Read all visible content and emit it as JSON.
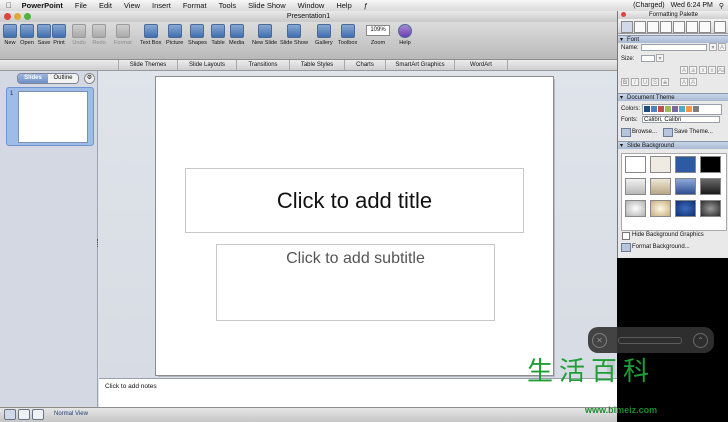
{
  "menubar": {
    "app": "PowerPoint",
    "items": [
      "File",
      "Edit",
      "View",
      "Insert",
      "Format",
      "Tools",
      "Slide Show",
      "Window",
      "Help"
    ],
    "battery": "(Charged)",
    "clock": "Wed 6:24 PM"
  },
  "window": {
    "title": "Presentation1"
  },
  "toolbar": {
    "buttons": [
      "New",
      "Open",
      "Save",
      "Print",
      "Undo",
      "Redo",
      "Format",
      "Text Box",
      "Picture",
      "Shapes",
      "Table",
      "Media",
      "New Slide",
      "Slide Show",
      "Gallery",
      "Toolbox",
      "Zoom",
      "Help"
    ],
    "zoom_value": "109%"
  },
  "ribbon": {
    "tabs": [
      "Slide Themes",
      "Slide Layouts",
      "Transitions",
      "Table Styles",
      "Charts",
      "SmartArt Graphics",
      "WordArt"
    ]
  },
  "leftpane": {
    "tab_slides": "Slides",
    "tab_outline": "Outline",
    "slide_number": "1"
  },
  "slide": {
    "title_placeholder": "Click to add title",
    "subtitle_placeholder": "Click to add subtitle"
  },
  "notes": {
    "placeholder": "Click to add notes"
  },
  "statusbar": {
    "view": "Normal View"
  },
  "palette": {
    "title": "Formatting Palette",
    "font_section": "Font",
    "name_label": "Name:",
    "size_label": "Size:",
    "doc_theme_section": "Document Theme",
    "colors_label": "Colors:",
    "fonts_label": "Fonts:",
    "fonts_value": "Calibri, Calibri",
    "browse": "Browse...",
    "save_theme": "Save Theme...",
    "slide_bg_section": "Slide Background",
    "hide_bg": "Hide Background Graphics",
    "format_bg": "Format Background..."
  },
  "watermark": {
    "chars": "生活百科",
    "url": "www.bimeiz.com"
  },
  "colors": {
    "theme_swatches": [
      "#1f497d",
      "#4f81bd",
      "#c0504d",
      "#9bbb59",
      "#8064a2",
      "#4bacc6",
      "#f79646",
      "#7f7f7f"
    ],
    "bg_swatches": [
      "#ffffff",
      "#efebe3",
      "#2e5aa3",
      "#000000",
      "#d0d0d0",
      "#d8cdb5",
      "#4d6fb3",
      "#3a3a3a",
      "#e8e8e8",
      "#e0d1ad",
      "#1d4fa0",
      "#6a6a6a"
    ]
  }
}
